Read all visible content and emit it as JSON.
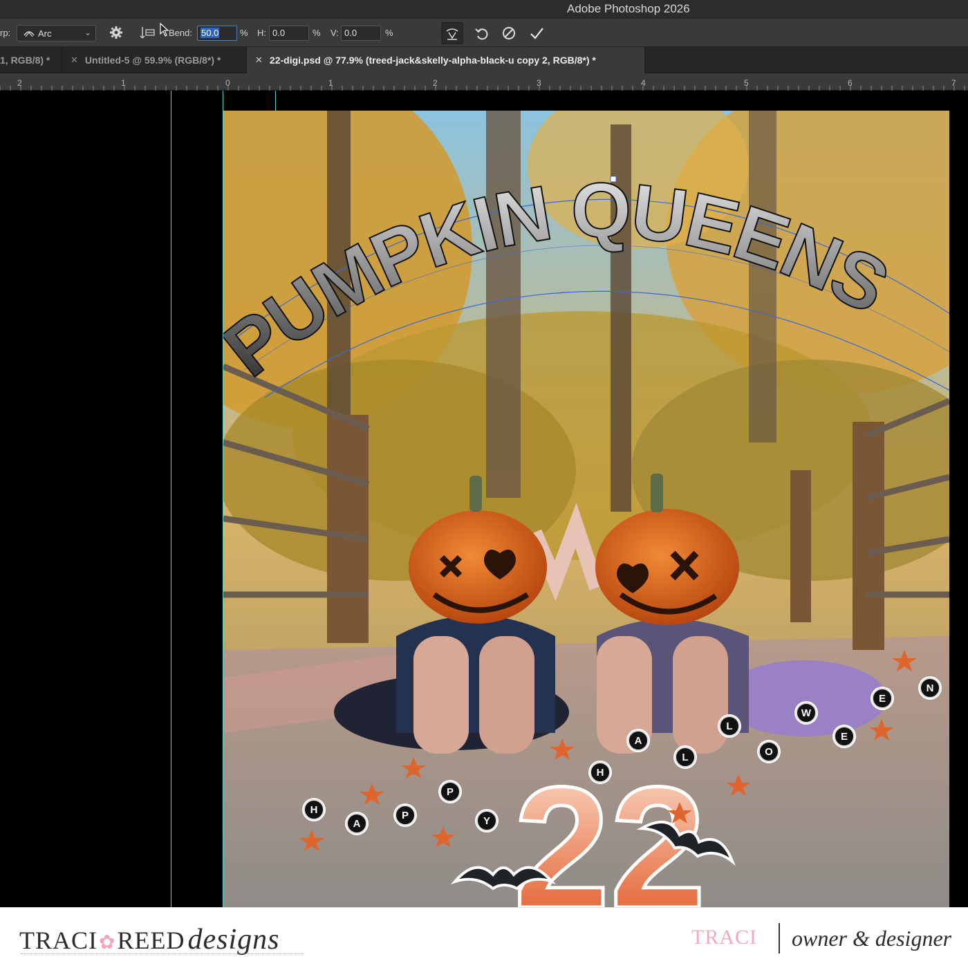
{
  "app": {
    "title": "Adobe Photoshop 2026"
  },
  "options": {
    "warp_label": "rp:",
    "warp_style": "Arc",
    "bend_label": "Bend:",
    "bend_value": "50.0",
    "h_label": "H:",
    "h_value": "0.0",
    "v_label": "V:",
    "v_value": "0.0",
    "percent": "%"
  },
  "tabs": [
    {
      "label": "1, RGB/8) *",
      "closable": false
    },
    {
      "label": "Untitled-5 @ 59.9% (RGB/8*) *",
      "closable": true
    },
    {
      "label": "22-digi.psd @ 77.9% (treed-jack&skelly-alpha-black-u copy 2, RGB/8*) *",
      "closable": true,
      "active": true
    }
  ],
  "ruler": {
    "labels": [
      "2",
      "1",
      "0",
      "1",
      "2",
      "3",
      "4",
      "5",
      "6",
      "7"
    ]
  },
  "artwork": {
    "arc_title": "PUMPKIN QUEENS",
    "number": "22",
    "beads_happy": [
      "H",
      "A",
      "P",
      "P",
      "Y"
    ],
    "beads_halloween": [
      "H",
      "A",
      "L",
      "L",
      "O",
      "W",
      "E",
      "E",
      "N"
    ]
  },
  "footer": {
    "brand_traci": "TRACI",
    "brand_reed": "REED",
    "brand_designs": "designs",
    "owner_name": "TRACI",
    "owner_title": "owner & designer"
  },
  "colors": {
    "selection": "#2f64b8",
    "guide": "#5fd3d6",
    "pink": "#f3a9b9",
    "pumpkin": "#e0651d"
  },
  "icons": [
    "warp-arc-icon",
    "gear-icon",
    "orientation-icon",
    "cursor-icon",
    "warp-mode-icon",
    "undo-icon",
    "cancel-icon",
    "commit-icon",
    "close-icon",
    "bat-icon",
    "star-icon"
  ]
}
